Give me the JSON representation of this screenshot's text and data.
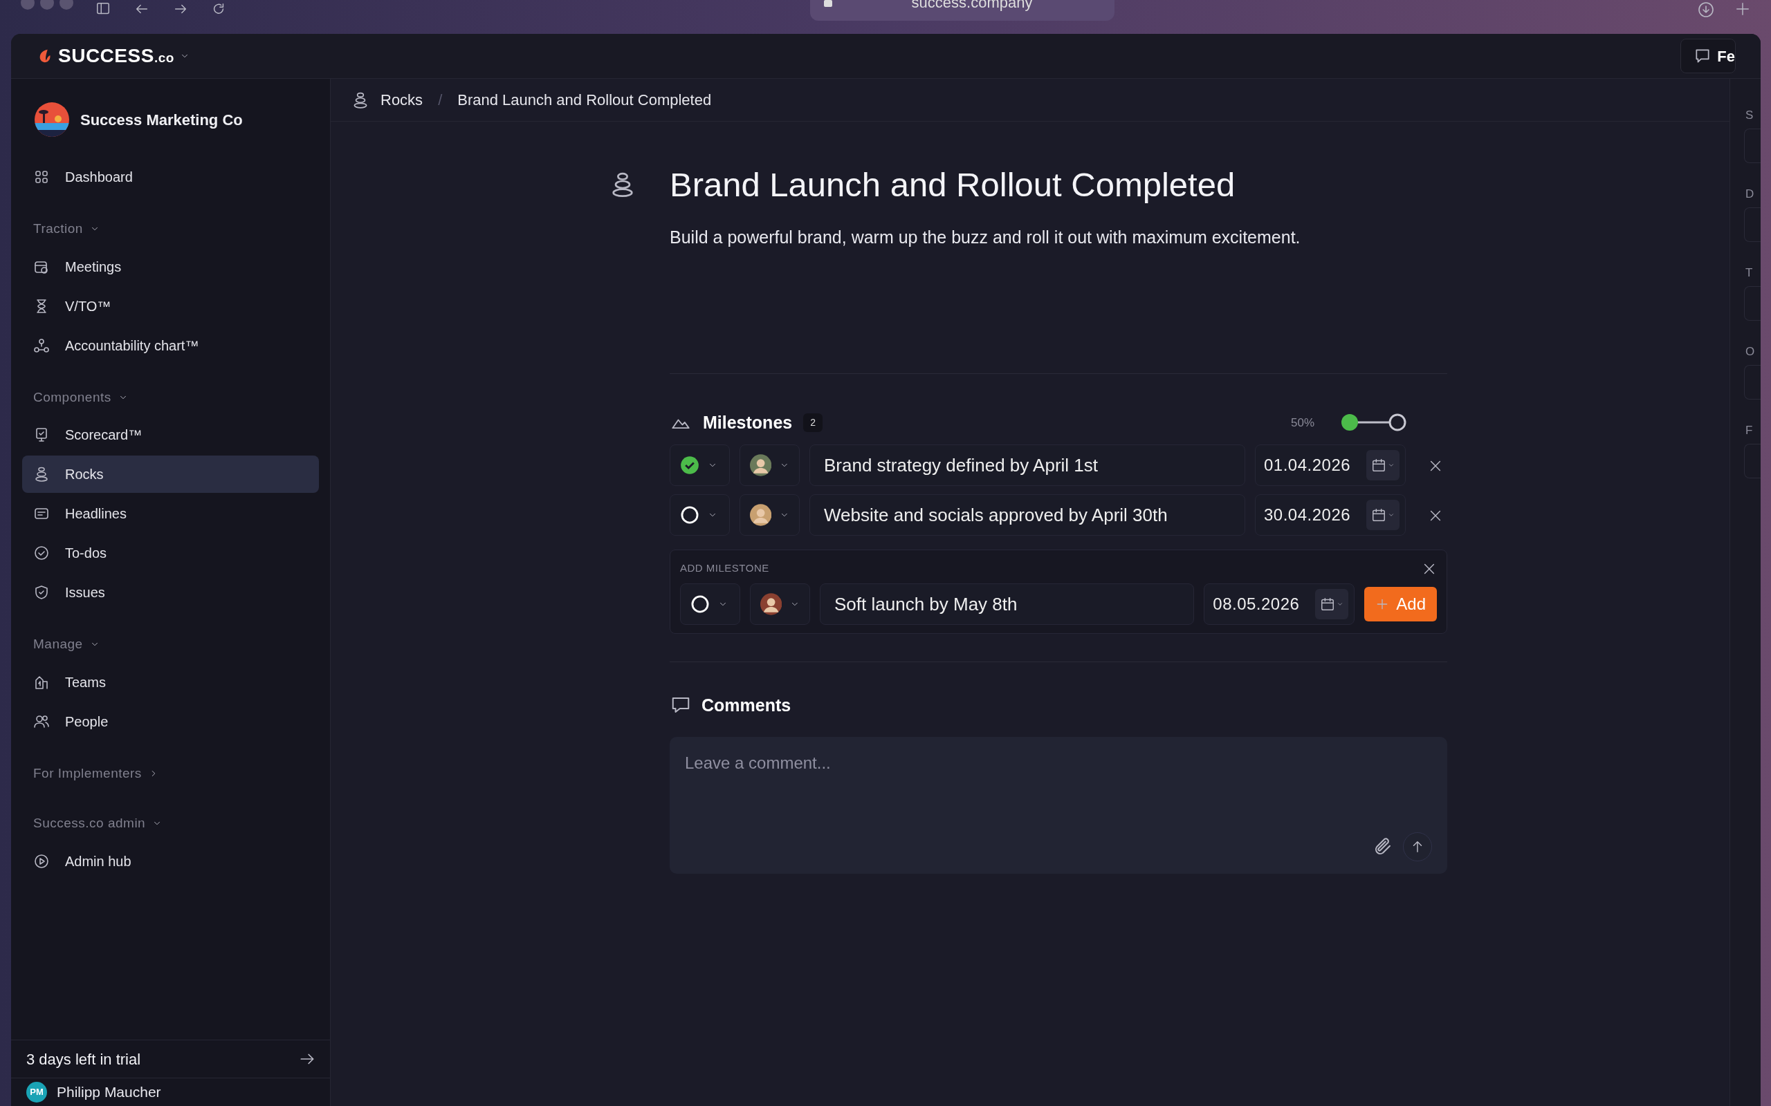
{
  "browser": {
    "url": "success.company"
  },
  "app_bar": {
    "brand": "SUCCESS",
    "brand_suffix": ".co",
    "feedback": "Fe"
  },
  "sidebar": {
    "org": "Success Marketing Co",
    "items": [
      {
        "kind": "link",
        "label": "Dashboard",
        "selected": false
      },
      {
        "kind": "group",
        "label": "Traction",
        "expanded": true
      },
      {
        "kind": "link",
        "label": "Meetings",
        "selected": false
      },
      {
        "kind": "link",
        "label": "V/TO™",
        "selected": false
      },
      {
        "kind": "link",
        "label": "Accountability chart™",
        "selected": false
      },
      {
        "kind": "group",
        "label": "Components",
        "expanded": true
      },
      {
        "kind": "link",
        "label": "Scorecard™",
        "selected": false
      },
      {
        "kind": "link",
        "label": "Rocks",
        "selected": true
      },
      {
        "kind": "link",
        "label": "Headlines",
        "selected": false
      },
      {
        "kind": "link",
        "label": "To-dos",
        "selected": false
      },
      {
        "kind": "link",
        "label": "Issues",
        "selected": false
      },
      {
        "kind": "group",
        "label": "Manage",
        "expanded": true
      },
      {
        "kind": "link",
        "label": "Teams",
        "selected": false
      },
      {
        "kind": "link",
        "label": "People",
        "selected": false
      },
      {
        "kind": "group",
        "label": "For Implementers",
        "expanded": false
      },
      {
        "kind": "group",
        "label": "Success.co admin",
        "expanded": true
      },
      {
        "kind": "link",
        "label": "Admin hub",
        "selected": false
      }
    ],
    "trial": "3 days left in trial",
    "user": {
      "initials": "PM",
      "name": "Philipp Maucher"
    }
  },
  "breadcrumb": {
    "items": [
      "Rocks",
      "Brand Launch and Rollout Completed"
    ],
    "separator": "/"
  },
  "rock": {
    "title": "Brand Launch and Rollout Completed",
    "description": "Build a powerful brand, warm up the buzz and roll it out with maximum excitement."
  },
  "milestones": {
    "title": "Milestones",
    "count": "2",
    "progress": "50%",
    "items": [
      {
        "done": true,
        "title": "Brand strategy defined by April 1st",
        "date": "01.04.2026"
      },
      {
        "done": false,
        "title": "Website and socials approved by April 30th",
        "date": "30.04.2026"
      }
    ],
    "add": {
      "label": "ADD MILESTONE",
      "done": false,
      "value": "Soft launch by May 8th",
      "date": "08.05.2026",
      "button": "Add"
    }
  },
  "comments": {
    "title": "Comments",
    "placeholder": "Leave a comment..."
  },
  "right_panel": {
    "labels": [
      "S",
      "D",
      "T",
      "O",
      "F"
    ]
  }
}
